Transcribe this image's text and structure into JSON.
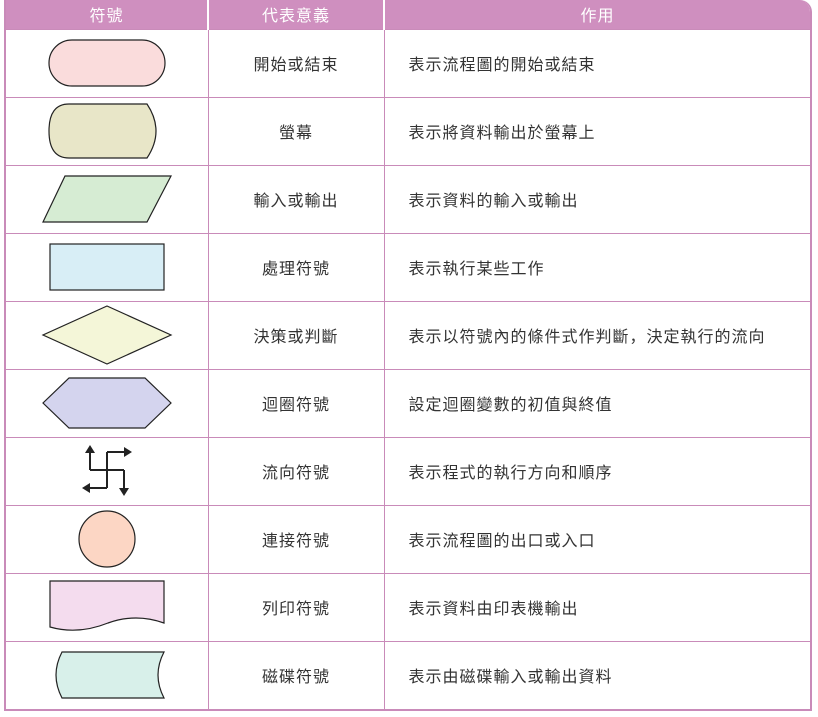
{
  "table": {
    "headers": {
      "symbol": "符號",
      "meaning": "代表意義",
      "usage": "作用"
    },
    "rows": [
      {
        "icon": "terminator-shape-icon",
        "fill": "#fadcdc",
        "meaning": "開始或結束",
        "usage": "表示流程圖的開始或結束"
      },
      {
        "icon": "display-shape-icon",
        "fill": "#e8e6c8",
        "meaning": "螢幕",
        "usage": "表示將資料輸出於螢幕上"
      },
      {
        "icon": "parallelogram-io-shape-icon",
        "fill": "#d6ecd3",
        "meaning": "輸入或輸出",
        "usage": "表示資料的輸入或輸出"
      },
      {
        "icon": "process-rectangle-shape-icon",
        "fill": "#d8eef6",
        "meaning": "處理符號",
        "usage": "表示執行某些工作"
      },
      {
        "icon": "decision-diamond-shape-icon",
        "fill": "#f4f6d8",
        "meaning": "決策或判斷",
        "usage": "表示以符號內的條件式作判斷，決定執行的流向"
      },
      {
        "icon": "loop-hexagon-shape-icon",
        "fill": "#d4d4ee",
        "meaning": "迴圈符號",
        "usage": "設定迴圈變數的初值與終值"
      },
      {
        "icon": "flow-arrows-icon",
        "fill": "#222222",
        "meaning": "流向符號",
        "usage": "表示程式的執行方向和順序"
      },
      {
        "icon": "connector-circle-shape-icon",
        "fill": "#fcd6c4",
        "meaning": "連接符號",
        "usage": "表示流程圖的出口或入口"
      },
      {
        "icon": "document-print-shape-icon",
        "fill": "#f4dcee",
        "meaning": "列印符號",
        "usage": "表示資料由印表機輸出"
      },
      {
        "icon": "disk-storage-shape-icon",
        "fill": "#d8f0ea",
        "meaning": "磁碟符號",
        "usage": "表示由磁碟輸入或輸出資料"
      }
    ]
  },
  "colors": {
    "header_bg": "#cf8fbf",
    "border": "#c98bb9",
    "text": "#333333"
  }
}
